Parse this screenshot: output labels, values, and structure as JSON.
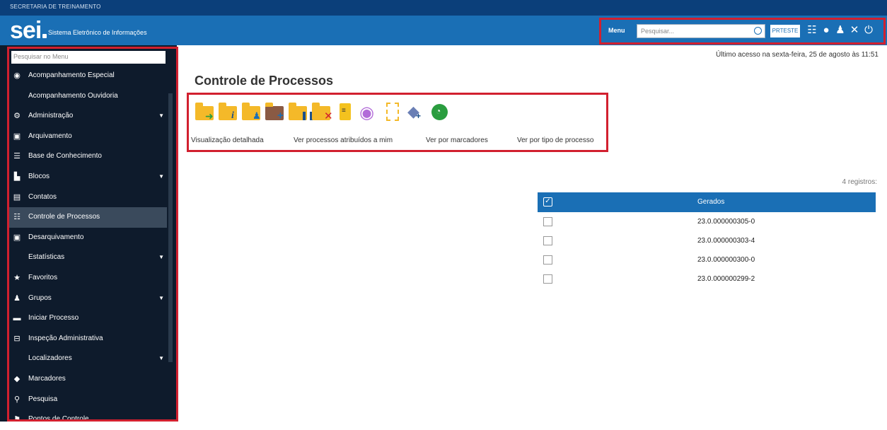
{
  "top_strip": {
    "org": "SECRETARIA DE TREINAMENTO"
  },
  "header": {
    "logo": "sei",
    "system_name": "Sistema Eletrônico de Informações",
    "menu_label": "Menu",
    "search_placeholder": "Pesquisar...",
    "unit_button": "PRTESTE",
    "icons": [
      "grid-icon",
      "info-icon",
      "user-icon",
      "tools-icon",
      "power-icon"
    ]
  },
  "sidebar": {
    "search_placeholder": "Pesquisar no Menu",
    "items": [
      {
        "label": "Acompanhamento Especial",
        "icon": "eye-icon",
        "submenu": false
      },
      {
        "label": "Acompanhamento Ouvidoria",
        "icon": "",
        "submenu": false
      },
      {
        "label": "Administração",
        "icon": "gears-icon",
        "submenu": true
      },
      {
        "label": "Arquivamento",
        "icon": "archive-icon",
        "submenu": false
      },
      {
        "label": "Base de Conhecimento",
        "icon": "database-icon",
        "submenu": false
      },
      {
        "label": "Blocos",
        "icon": "blocks-icon",
        "submenu": true
      },
      {
        "label": "Contatos",
        "icon": "contact-card-icon",
        "submenu": false
      },
      {
        "label": "Controle de Processos",
        "icon": "list-icon",
        "submenu": false,
        "active": true
      },
      {
        "label": "Desarquivamento",
        "icon": "unarchive-icon",
        "submenu": false
      },
      {
        "label": "Estatísticas",
        "icon": "",
        "submenu": true
      },
      {
        "label": "Favoritos",
        "icon": "star-icon",
        "submenu": false
      },
      {
        "label": "Grupos",
        "icon": "users-icon",
        "submenu": true
      },
      {
        "label": "Iniciar Processo",
        "icon": "folder-icon",
        "submenu": false
      },
      {
        "label": "Inspeção Administrativa",
        "icon": "inspection-icon",
        "submenu": false
      },
      {
        "label": "Localizadores",
        "icon": "",
        "submenu": true
      },
      {
        "label": "Marcadores",
        "icon": "tag-icon",
        "submenu": false
      },
      {
        "label": "Pesquisa",
        "icon": "search-icon",
        "submenu": false
      },
      {
        "label": "Pontos de Controle",
        "icon": "flag-icon",
        "submenu": false
      }
    ]
  },
  "main": {
    "last_access": "Último acesso na sexta-feira, 25 de agosto às 11:51",
    "title": "Controle de Processos",
    "toolbar_icons": [
      "send-process-icon",
      "process-info-icon",
      "assign-process-icon",
      "add-block-icon",
      "suspend-process-icon",
      "close-process-icon",
      "document-icon",
      "view-icon",
      "new-document-icon",
      "add-marker-icon",
      "deadline-icon"
    ],
    "links": [
      "Visualização detalhada",
      "Ver processos atribuídos a mim",
      "Ver por marcadores",
      "Ver por tipo de processo"
    ],
    "record_count": "4 registros:",
    "table": {
      "header": "Gerados",
      "rows": [
        "23.0.000000305-0",
        "23.0.000000303-4",
        "23.0.000000300-0",
        "23.0.000000299-2"
      ]
    }
  },
  "colors": {
    "header_blue": "#1a6fb5",
    "dark_strip": "#0b3f7a",
    "sidebar": "#0e1b2c",
    "highlight": "#d2202f",
    "folder": "#f4b929"
  }
}
